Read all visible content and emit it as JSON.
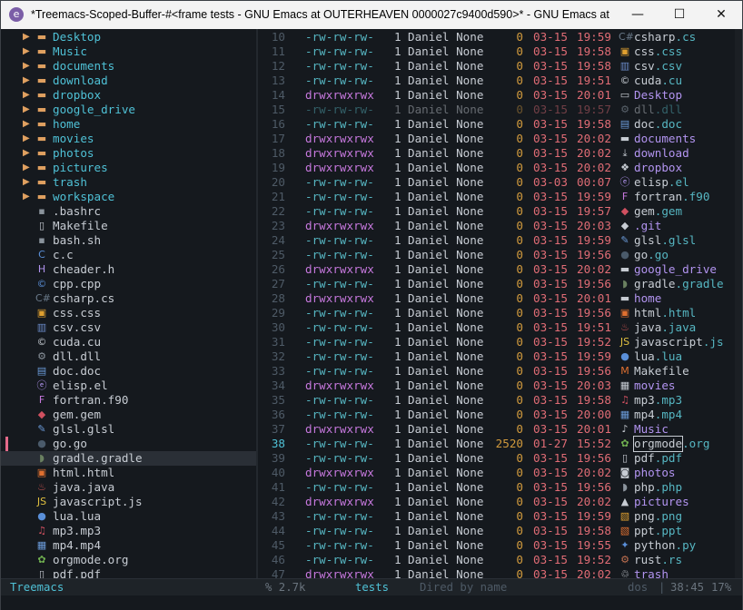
{
  "window": {
    "title": "*Treemacs-Scoped-Buffer-#<frame tests - GNU Emacs at OUTERHEAVEN 0000027c9400d590>* - GNU Emacs at OUTER...",
    "minimize_glyph": "—",
    "maximize_glyph": "☐",
    "close_glyph": "✕"
  },
  "colors": {
    "dir": "#4fc1d6",
    "file": "#c7ccd3",
    "perm_dir": "#c678dd",
    "perm_file": "#56b6c2",
    "date": "#e06c75",
    "size": "#d19a3d",
    "accent": "#e36a8a"
  },
  "treemacs": {
    "selected_index": 29,
    "items": [
      {
        "label": "Desktop",
        "type": "dir",
        "icon": "folder-icon",
        "glyph": "▬",
        "color": "#e0a060"
      },
      {
        "label": "Music",
        "type": "dir",
        "icon": "folder-icon",
        "glyph": "▬",
        "color": "#e0a060"
      },
      {
        "label": "documents",
        "type": "dir",
        "icon": "folder-icon",
        "glyph": "▬",
        "color": "#e0a060"
      },
      {
        "label": "download",
        "type": "dir",
        "icon": "folder-icon",
        "glyph": "▬",
        "color": "#e0a060"
      },
      {
        "label": "dropbox",
        "type": "dir",
        "icon": "folder-icon",
        "glyph": "▬",
        "color": "#e0a060"
      },
      {
        "label": "google_drive",
        "type": "dir",
        "icon": "folder-icon",
        "glyph": "▬",
        "color": "#e0a060"
      },
      {
        "label": "home",
        "type": "dir",
        "icon": "folder-icon",
        "glyph": "▬",
        "color": "#e0a060"
      },
      {
        "label": "movies",
        "type": "dir",
        "icon": "folder-icon",
        "glyph": "▬",
        "color": "#e0a060"
      },
      {
        "label": "photos",
        "type": "dir",
        "icon": "folder-icon",
        "glyph": "▬",
        "color": "#e0a060"
      },
      {
        "label": "pictures",
        "type": "dir",
        "icon": "folder-icon",
        "glyph": "▬",
        "color": "#e0a060"
      },
      {
        "label": "trash",
        "type": "dir",
        "icon": "folder-icon",
        "glyph": "▬",
        "color": "#e0a060"
      },
      {
        "label": "workspace",
        "type": "dir",
        "icon": "folder-icon",
        "glyph": "▬",
        "color": "#e0a060"
      },
      {
        "label": ".bashrc",
        "type": "file",
        "icon": "terminal-icon",
        "glyph": "▪",
        "color": "#8a939c"
      },
      {
        "label": "Makefile",
        "type": "file",
        "icon": "document-icon",
        "glyph": "▯",
        "color": "#c7ccd3"
      },
      {
        "label": "bash.sh",
        "type": "file",
        "icon": "terminal-icon",
        "glyph": "▪",
        "color": "#8a939c"
      },
      {
        "label": "c.c",
        "type": "file",
        "icon": "c-icon",
        "glyph": "C",
        "color": "#5a8fd8"
      },
      {
        "label": "cheader.h",
        "type": "file",
        "icon": "h-icon",
        "glyph": "H",
        "color": "#b294f0"
      },
      {
        "label": "cpp.cpp",
        "type": "file",
        "icon": "cpp-icon",
        "glyph": "©",
        "color": "#5a8fd8"
      },
      {
        "label": "csharp.cs",
        "type": "file",
        "icon": "csharp-icon",
        "glyph": "C#",
        "color": "#6a7a8a"
      },
      {
        "label": "css.css",
        "type": "file",
        "icon": "css-icon",
        "glyph": "▣",
        "color": "#e0a030"
      },
      {
        "label": "csv.csv",
        "type": "file",
        "icon": "chart-icon",
        "glyph": "▥",
        "color": "#6a8ac8"
      },
      {
        "label": "cuda.cu",
        "type": "file",
        "icon": "cuda-icon",
        "glyph": "©",
        "color": "#c7ccd3"
      },
      {
        "label": "dll.dll",
        "type": "file",
        "icon": "gears-icon",
        "glyph": "⚙",
        "color": "#8a939c"
      },
      {
        "label": "doc.doc",
        "type": "file",
        "icon": "word-icon",
        "glyph": "▤",
        "color": "#6a9ad8"
      },
      {
        "label": "elisp.el",
        "type": "file",
        "icon": "emacs-icon",
        "glyph": "ⓔ",
        "color": "#b294f0"
      },
      {
        "label": "fortran.f90",
        "type": "file",
        "icon": "fortran-icon",
        "glyph": "F",
        "color": "#c678dd"
      },
      {
        "label": "gem.gem",
        "type": "file",
        "icon": "gem-icon",
        "glyph": "◆",
        "color": "#d05060"
      },
      {
        "label": "glsl.glsl",
        "type": "file",
        "icon": "brush-icon",
        "glyph": "✎",
        "color": "#6a9ad8"
      },
      {
        "label": "go.go",
        "type": "file",
        "icon": "gopher-icon",
        "glyph": "●",
        "color": "#4a5a6a"
      },
      {
        "label": "gradle.gradle",
        "type": "file",
        "icon": "gradle-icon",
        "glyph": "◗",
        "color": "#6a8060"
      },
      {
        "label": "html.html",
        "type": "file",
        "icon": "html-icon",
        "glyph": "▣",
        "color": "#e07030"
      },
      {
        "label": "java.java",
        "type": "file",
        "icon": "java-icon",
        "glyph": "♨",
        "color": "#c05050"
      },
      {
        "label": "javascript.js",
        "type": "file",
        "icon": "js-icon",
        "glyph": "JS",
        "color": "#e0c040"
      },
      {
        "label": "lua.lua",
        "type": "file",
        "icon": "lua-icon",
        "glyph": "●",
        "color": "#5a8fd8"
      },
      {
        "label": "mp3.mp3",
        "type": "file",
        "icon": "music-note-icon",
        "glyph": "♫",
        "color": "#d05060"
      },
      {
        "label": "mp4.mp4",
        "type": "file",
        "icon": "film-icon",
        "glyph": "▦",
        "color": "#6a9ad8"
      },
      {
        "label": "orgmode.org",
        "type": "file",
        "icon": "unicorn-icon",
        "glyph": "✿",
        "color": "#70b050"
      },
      {
        "label": "pdf.pdf",
        "type": "file",
        "icon": "pdf-icon",
        "glyph": "▯",
        "color": "#c7ccd3"
      }
    ]
  },
  "dired": {
    "cursor_line": 38,
    "rows": [
      {
        "line": "10",
        "perm": "-rw-rw-rw-",
        "links": "1",
        "owner": "Daniel None",
        "size": "0",
        "date": "03-15",
        "time": "19:59",
        "icon": "csharp-icon",
        "glyph": "C#",
        "icolor": "#6a7a8a",
        "base": "csharp",
        "ext": ".cs",
        "dir": false
      },
      {
        "line": "11",
        "perm": "-rw-rw-rw-",
        "links": "1",
        "owner": "Daniel None",
        "size": "0",
        "date": "03-15",
        "time": "19:58",
        "icon": "css-icon",
        "glyph": "▣",
        "icolor": "#e0a030",
        "base": "css",
        "ext": ".css",
        "dir": false
      },
      {
        "line": "12",
        "perm": "-rw-rw-rw-",
        "links": "1",
        "owner": "Daniel None",
        "size": "0",
        "date": "03-15",
        "time": "19:58",
        "icon": "chart-icon",
        "glyph": "▥",
        "icolor": "#6a8ac8",
        "base": "csv",
        "ext": ".csv",
        "dir": false
      },
      {
        "line": "13",
        "perm": "-rw-rw-rw-",
        "links": "1",
        "owner": "Daniel None",
        "size": "0",
        "date": "03-15",
        "time": "19:51",
        "icon": "cuda-icon",
        "glyph": "©",
        "icolor": "#c7ccd3",
        "base": "cuda",
        "ext": ".cu",
        "dir": false
      },
      {
        "line": "14",
        "perm": "drwxrwxrwx",
        "links": "1",
        "owner": "Daniel None",
        "size": "0",
        "date": "03-15",
        "time": "20:01",
        "icon": "desktop-icon",
        "glyph": "▭",
        "icolor": "#c7ccd3",
        "base": "Desktop",
        "ext": "",
        "dir": true
      },
      {
        "line": "15",
        "perm": "-rw-rw-rw-",
        "links": "1",
        "owner": "Daniel None",
        "size": "0",
        "date": "03-15",
        "time": "19:57",
        "icon": "gears-icon",
        "glyph": "⚙",
        "icolor": "#5a636c",
        "base": "dll",
        "ext": ".dll",
        "dir": false,
        "dim": true
      },
      {
        "line": "16",
        "perm": "-rw-rw-rw-",
        "links": "1",
        "owner": "Daniel None",
        "size": "0",
        "date": "03-15",
        "time": "19:58",
        "icon": "word-icon",
        "glyph": "▤",
        "icolor": "#6a9ad8",
        "base": "doc",
        "ext": ".doc",
        "dir": false
      },
      {
        "line": "17",
        "perm": "drwxrwxrwx",
        "links": "1",
        "owner": "Daniel None",
        "size": "0",
        "date": "03-15",
        "time": "20:02",
        "icon": "folder-icon",
        "glyph": "▬",
        "icolor": "#c7ccd3",
        "base": "documents",
        "ext": "",
        "dir": true
      },
      {
        "line": "18",
        "perm": "drwxrwxrwx",
        "links": "1",
        "owner": "Daniel None",
        "size": "0",
        "date": "03-15",
        "time": "20:02",
        "icon": "download-icon",
        "glyph": "⤓",
        "icolor": "#c7ccd3",
        "base": "download",
        "ext": "",
        "dir": true
      },
      {
        "line": "19",
        "perm": "drwxrwxrwx",
        "links": "1",
        "owner": "Daniel None",
        "size": "0",
        "date": "03-15",
        "time": "20:02",
        "icon": "dropbox-icon",
        "glyph": "❖",
        "icolor": "#c7ccd3",
        "base": "dropbox",
        "ext": "",
        "dir": true
      },
      {
        "line": "20",
        "perm": "-rw-rw-rw-",
        "links": "1",
        "owner": "Daniel None",
        "size": "0",
        "date": "03-03",
        "time": "00:07",
        "icon": "emacs-icon",
        "glyph": "ⓔ",
        "icolor": "#b294f0",
        "base": "elisp",
        "ext": ".el",
        "dir": false
      },
      {
        "line": "21",
        "perm": "-rw-rw-rw-",
        "links": "1",
        "owner": "Daniel None",
        "size": "0",
        "date": "03-15",
        "time": "19:59",
        "icon": "fortran-icon",
        "glyph": "F",
        "icolor": "#c678dd",
        "base": "fortran",
        "ext": ".f90",
        "dir": false
      },
      {
        "line": "22",
        "perm": "-rw-rw-rw-",
        "links": "1",
        "owner": "Daniel None",
        "size": "0",
        "date": "03-15",
        "time": "19:57",
        "icon": "gem-icon",
        "glyph": "◆",
        "icolor": "#d05060",
        "base": "gem",
        "ext": ".gem",
        "dir": false
      },
      {
        "line": "23",
        "perm": "drwxrwxrwx",
        "links": "1",
        "owner": "Daniel None",
        "size": "0",
        "date": "03-15",
        "time": "20:03",
        "icon": "git-icon",
        "glyph": "◆",
        "icolor": "#c7ccd3",
        "base": ".git",
        "ext": "",
        "dir": true
      },
      {
        "line": "24",
        "perm": "-rw-rw-rw-",
        "links": "1",
        "owner": "Daniel None",
        "size": "0",
        "date": "03-15",
        "time": "19:59",
        "icon": "brush-icon",
        "glyph": "✎",
        "icolor": "#6a9ad8",
        "base": "glsl",
        "ext": ".glsl",
        "dir": false
      },
      {
        "line": "25",
        "perm": "-rw-rw-rw-",
        "links": "1",
        "owner": "Daniel None",
        "size": "0",
        "date": "03-15",
        "time": "19:56",
        "icon": "gopher-icon",
        "glyph": "●",
        "icolor": "#4a5a6a",
        "base": "go",
        "ext": ".go",
        "dir": false
      },
      {
        "line": "26",
        "perm": "drwxrwxrwx",
        "links": "1",
        "owner": "Daniel None",
        "size": "0",
        "date": "03-15",
        "time": "20:02",
        "icon": "folder-icon",
        "glyph": "▬",
        "icolor": "#c7ccd3",
        "base": "google_drive",
        "ext": "",
        "dir": true
      },
      {
        "line": "27",
        "perm": "-rw-rw-rw-",
        "links": "1",
        "owner": "Daniel None",
        "size": "0",
        "date": "03-15",
        "time": "19:56",
        "icon": "gradle-icon",
        "glyph": "◗",
        "icolor": "#6a8060",
        "base": "gradle",
        "ext": ".gradle",
        "dir": false
      },
      {
        "line": "28",
        "perm": "drwxrwxrwx",
        "links": "1",
        "owner": "Daniel None",
        "size": "0",
        "date": "03-15",
        "time": "20:01",
        "icon": "folder-icon",
        "glyph": "▬",
        "icolor": "#c7ccd3",
        "base": "home",
        "ext": "",
        "dir": true
      },
      {
        "line": "29",
        "perm": "-rw-rw-rw-",
        "links": "1",
        "owner": "Daniel None",
        "size": "0",
        "date": "03-15",
        "time": "19:56",
        "icon": "html-icon",
        "glyph": "▣",
        "icolor": "#e07030",
        "base": "html",
        "ext": ".html",
        "dir": false
      },
      {
        "line": "30",
        "perm": "-rw-rw-rw-",
        "links": "1",
        "owner": "Daniel None",
        "size": "0",
        "date": "03-15",
        "time": "19:51",
        "icon": "java-icon",
        "glyph": "♨",
        "icolor": "#c05050",
        "base": "java",
        "ext": ".java",
        "dir": false
      },
      {
        "line": "31",
        "perm": "-rw-rw-rw-",
        "links": "1",
        "owner": "Daniel None",
        "size": "0",
        "date": "03-15",
        "time": "19:52",
        "icon": "js-icon",
        "glyph": "JS",
        "icolor": "#e0c040",
        "base": "javascript",
        "ext": ".js",
        "dir": false
      },
      {
        "line": "32",
        "perm": "-rw-rw-rw-",
        "links": "1",
        "owner": "Daniel None",
        "size": "0",
        "date": "03-15",
        "time": "19:59",
        "icon": "lua-icon",
        "glyph": "●",
        "icolor": "#5a8fd8",
        "base": "lua",
        "ext": ".lua",
        "dir": false
      },
      {
        "line": "33",
        "perm": "-rw-rw-rw-",
        "links": "1",
        "owner": "Daniel None",
        "size": "0",
        "date": "03-15",
        "time": "19:56",
        "icon": "m-icon",
        "glyph": "M",
        "icolor": "#e07030",
        "base": "Makefile",
        "ext": "",
        "dir": false
      },
      {
        "line": "34",
        "perm": "drwxrwxrwx",
        "links": "1",
        "owner": "Daniel None",
        "size": "0",
        "date": "03-15",
        "time": "20:03",
        "icon": "film-icon",
        "glyph": "▦",
        "icolor": "#c7ccd3",
        "base": "movies",
        "ext": "",
        "dir": true
      },
      {
        "line": "35",
        "perm": "-rw-rw-rw-",
        "links": "1",
        "owner": "Daniel None",
        "size": "0",
        "date": "03-15",
        "time": "19:58",
        "icon": "music-note-icon",
        "glyph": "♫",
        "icolor": "#d05060",
        "base": "mp3",
        "ext": ".mp3",
        "dir": false
      },
      {
        "line": "36",
        "perm": "-rw-rw-rw-",
        "links": "1",
        "owner": "Daniel None",
        "size": "0",
        "date": "03-15",
        "time": "20:00",
        "icon": "film-icon",
        "glyph": "▦",
        "icolor": "#6a9ad8",
        "base": "mp4",
        "ext": ".mp4",
        "dir": false
      },
      {
        "line": "37",
        "perm": "drwxrwxrwx",
        "links": "1",
        "owner": "Daniel None",
        "size": "0",
        "date": "03-15",
        "time": "20:01",
        "icon": "music-folder-icon",
        "glyph": "♪",
        "icolor": "#c7ccd3",
        "base": "Music",
        "ext": "",
        "dir": true
      },
      {
        "line": "38",
        "perm": "-rw-rw-rw-",
        "links": "1",
        "owner": "Daniel None",
        "size": "2520",
        "date": "01-27",
        "time": "15:52",
        "icon": "unicorn-icon",
        "glyph": "✿",
        "icolor": "#70b050",
        "base": "orgmode",
        "ext": ".org",
        "dir": false,
        "cursor": true
      },
      {
        "line": "39",
        "perm": "-rw-rw-rw-",
        "links": "1",
        "owner": "Daniel None",
        "size": "0",
        "date": "03-15",
        "time": "19:56",
        "icon": "pdf-icon",
        "glyph": "▯",
        "icolor": "#c7ccd3",
        "base": "pdf",
        "ext": ".pdf",
        "dir": false
      },
      {
        "line": "40",
        "perm": "drwxrwxrwx",
        "links": "1",
        "owner": "Daniel None",
        "size": "0",
        "date": "03-15",
        "time": "20:02",
        "icon": "camera-icon",
        "glyph": "◙",
        "icolor": "#c7ccd3",
        "base": "photos",
        "ext": "",
        "dir": true
      },
      {
        "line": "41",
        "perm": "-rw-rw-rw-",
        "links": "1",
        "owner": "Daniel None",
        "size": "0",
        "date": "03-15",
        "time": "19:56",
        "icon": "php-icon",
        "glyph": "◗",
        "icolor": "#8a939c",
        "base": "php",
        "ext": ".php",
        "dir": false
      },
      {
        "line": "42",
        "perm": "drwxrwxrwx",
        "links": "1",
        "owner": "Daniel None",
        "size": "0",
        "date": "03-15",
        "time": "20:02",
        "icon": "image-icon",
        "glyph": "▲",
        "icolor": "#c7ccd3",
        "base": "pictures",
        "ext": "",
        "dir": true
      },
      {
        "line": "43",
        "perm": "-rw-rw-rw-",
        "links": "1",
        "owner": "Daniel None",
        "size": "0",
        "date": "03-15",
        "time": "19:59",
        "icon": "image-icon",
        "glyph": "▧",
        "icolor": "#e0a030",
        "base": "png",
        "ext": ".png",
        "dir": false
      },
      {
        "line": "44",
        "perm": "-rw-rw-rw-",
        "links": "1",
        "owner": "Daniel None",
        "size": "0",
        "date": "03-15",
        "time": "19:58",
        "icon": "ppt-icon",
        "glyph": "▧",
        "icolor": "#e07030",
        "base": "ppt",
        "ext": ".ppt",
        "dir": false
      },
      {
        "line": "45",
        "perm": "-rw-rw-rw-",
        "links": "1",
        "owner": "Daniel None",
        "size": "0",
        "date": "03-15",
        "time": "19:55",
        "icon": "python-icon",
        "glyph": "✦",
        "icolor": "#5a8fd8",
        "base": "python",
        "ext": ".py",
        "dir": false
      },
      {
        "line": "46",
        "perm": "-rw-rw-rw-",
        "links": "1",
        "owner": "Daniel None",
        "size": "0",
        "date": "03-15",
        "time": "19:52",
        "icon": "rust-icon",
        "glyph": "⚙",
        "icolor": "#c07050",
        "base": "rust",
        "ext": ".rs",
        "dir": false
      },
      {
        "line": "47",
        "perm": "drwxrwxrwx",
        "links": "1",
        "owner": "Daniel None",
        "size": "0",
        "date": "03-15",
        "time": "20:02",
        "icon": "trash-icon",
        "glyph": "♲",
        "icolor": "#c7ccd3",
        "base": "trash",
        "ext": "",
        "dir": true
      }
    ]
  },
  "modeline": {
    "left_name": "Treemacs",
    "modified_marker": "% 2.7k",
    "buffer_name": "tests",
    "mode": "Dired by name",
    "eol": "dos",
    "sep": "|",
    "position": "38:45",
    "percent": "17%"
  }
}
